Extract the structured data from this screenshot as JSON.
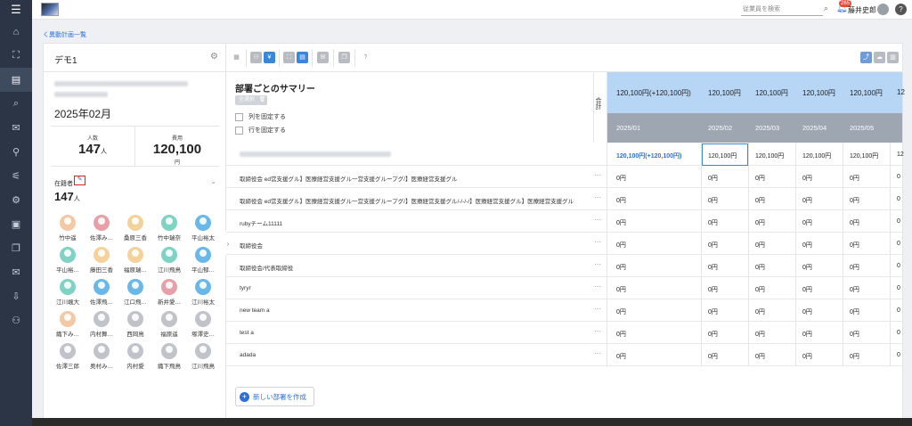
{
  "rail": [
    "☰",
    "⌂",
    "⛶",
    "▤",
    "⌕",
    "✉",
    "⚲",
    "⚟",
    "⚙",
    "▣",
    "❐",
    "✉",
    "⇩",
    "⚇"
  ],
  "topbar": {
    "search_placeholder": "従業員を検索",
    "notification_count": "265",
    "user_name": "藤井史郎",
    "help": "?"
  },
  "back_link": "く異動計画一覧",
  "left_panel": {
    "title": "デモ1",
    "month": "2025年02月",
    "stats": [
      {
        "label": "人数",
        "value": "147",
        "unit_inline": "人",
        "unit": ""
      },
      {
        "label": "費用",
        "value": "120,100",
        "unit_inline": "",
        "unit": "円"
      }
    ],
    "roster_label": "在籍者",
    "roster_count": "147",
    "roster_unit": "人",
    "people": [
      {
        "name": "竹中遥",
        "style": "a1"
      },
      {
        "name": "佐澤み…",
        "style": "a2"
      },
      {
        "name": "桑原三香",
        "style": "a3"
      },
      {
        "name": "竹中瑞奈",
        "style": "a4"
      },
      {
        "name": "平山裕太",
        "style": "a5"
      },
      {
        "name": "平山裕…",
        "style": "a4"
      },
      {
        "name": "藤田三香",
        "style": "a3"
      },
      {
        "name": "福原瑞…",
        "style": "a3"
      },
      {
        "name": "江川飛鳥",
        "style": "a4"
      },
      {
        "name": "平山郁…",
        "style": "a5"
      },
      {
        "name": "江川颯大",
        "style": "a4"
      },
      {
        "name": "佐澤飛…",
        "style": "a5"
      },
      {
        "name": "江口飛…",
        "style": "a5"
      },
      {
        "name": "新井愛…",
        "style": "a2"
      },
      {
        "name": "江川裕太",
        "style": "a5"
      },
      {
        "name": "織下み…",
        "style": "a1"
      },
      {
        "name": "内村舞…",
        "style": "a6"
      },
      {
        "name": "西岡鳥",
        "style": "a6"
      },
      {
        "name": "福原遥",
        "style": "a6"
      },
      {
        "name": "塚澤史…",
        "style": "a6"
      },
      {
        "name": "佐澤三郎",
        "style": "a6"
      },
      {
        "name": "奥村み…",
        "style": "a6"
      },
      {
        "name": "内村愛",
        "style": "a6"
      },
      {
        "name": "織下飛鳥",
        "style": "a6"
      },
      {
        "name": "江川飛鳥",
        "style": "a6"
      }
    ]
  },
  "summary": {
    "title": "部署ごとのサマリー",
    "select_all": "全選択",
    "fix_columns": "列を固定する",
    "fix_rows": "行を固定する",
    "total_label": "合計"
  },
  "months": [
    {
      "label": "2025/01",
      "header_value": "120,100円(+120,100円)"
    },
    {
      "label": "2025/02",
      "header_value": "120,100円"
    },
    {
      "label": "2025/03",
      "header_value": "120,100円"
    },
    {
      "label": "2025/04",
      "header_value": "120,100円"
    },
    {
      "label": "2025/05",
      "header_value": "120,100円"
    },
    {
      "label": "",
      "header_value": "12"
    }
  ],
  "rows": [
    {
      "label": "",
      "cells": [
        "120,100円(+120,100円)",
        "120,100円",
        "120,100円",
        "120,100円",
        "120,100円",
        "12"
      ]
    },
    {
      "label": "取締役会 ed営支援グル】医療経営支援グル一営支援グループグ/】医療経営支援グル",
      "cells": [
        "0円",
        "0円",
        "0円",
        "0円",
        "0円",
        "0"
      ]
    },
    {
      "label": "取締役会 ed営支援グル】医療経営支援グル一営支援グループグ/】医療経営支援グル/-/-/-/】医療経営支援グル】医療経営支援グル",
      "cells": [
        "0円",
        "0円",
        "0円",
        "0円",
        "0円",
        "0"
      ]
    },
    {
      "label": "rubyチーム11111",
      "cells": [
        "0円",
        "0円",
        "0円",
        "0円",
        "0円",
        "0"
      ]
    },
    {
      "label": "取締役会",
      "cells": [
        "0円",
        "0円",
        "0円",
        "0円",
        "0円",
        "0"
      ]
    },
    {
      "label": "取締役会/代表取締役",
      "cells": [
        "0円",
        "0円",
        "0円",
        "0円",
        "0円",
        "0"
      ]
    },
    {
      "label": "tyryr",
      "cells": [
        "0円",
        "0円",
        "0円",
        "0円",
        "0円",
        "0"
      ]
    },
    {
      "label": "new team a",
      "cells": [
        "0円",
        "0円",
        "0円",
        "0円",
        "0円",
        "0"
      ]
    },
    {
      "label": "test a",
      "cells": [
        "0円",
        "0円",
        "0円",
        "0円",
        "0円",
        "0"
      ]
    },
    {
      "label": "adada",
      "cells": [
        "0円",
        "0円",
        "0円",
        "0円",
        "0円",
        "0"
      ]
    }
  ],
  "create_button": "新しい部署を作成"
}
